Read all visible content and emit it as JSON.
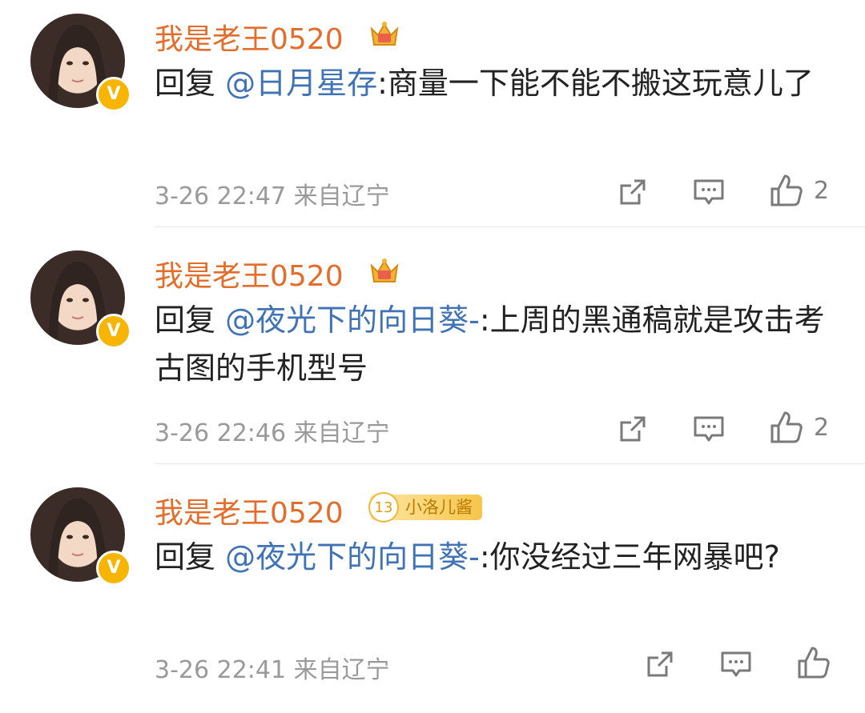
{
  "comments": [
    {
      "username": "我是老王0520",
      "badge_type": "crown",
      "reply_prefix": "回复 ",
      "mention": "@日月星存",
      "body": ":商量一下能不能不搬这玩意儿了",
      "time": "3-26 22:47",
      "location": "来自辽宁",
      "likes": "2"
    },
    {
      "username": "我是老王0520",
      "badge_type": "crown",
      "reply_prefix": "回复 ",
      "mention": "@夜光下的向日葵-",
      "body": ":上周的黑通稿就是攻击考古图的手机型号",
      "time": "3-26 22:46",
      "location": "来自辽宁",
      "likes": "2"
    },
    {
      "username": "我是老王0520",
      "badge_type": "fan",
      "fan_badge": {
        "level": "13",
        "label": "小洛儿酱"
      },
      "reply_prefix": "回复 ",
      "mention": "@夜光下的向日葵-",
      "body": ":你没经过三年网暴吧?",
      "time": "3-26 22:41",
      "location": "来自辽宁",
      "likes": ""
    }
  ],
  "verified_mark": "V",
  "icons": [
    "share-icon",
    "comment-icon",
    "like-icon",
    "crown-icon",
    "verified-icon"
  ],
  "colors": {
    "username": "#e36d2b",
    "mention": "#3f73b5",
    "meta": "#9a9a9a",
    "verified": "#f7b500"
  }
}
